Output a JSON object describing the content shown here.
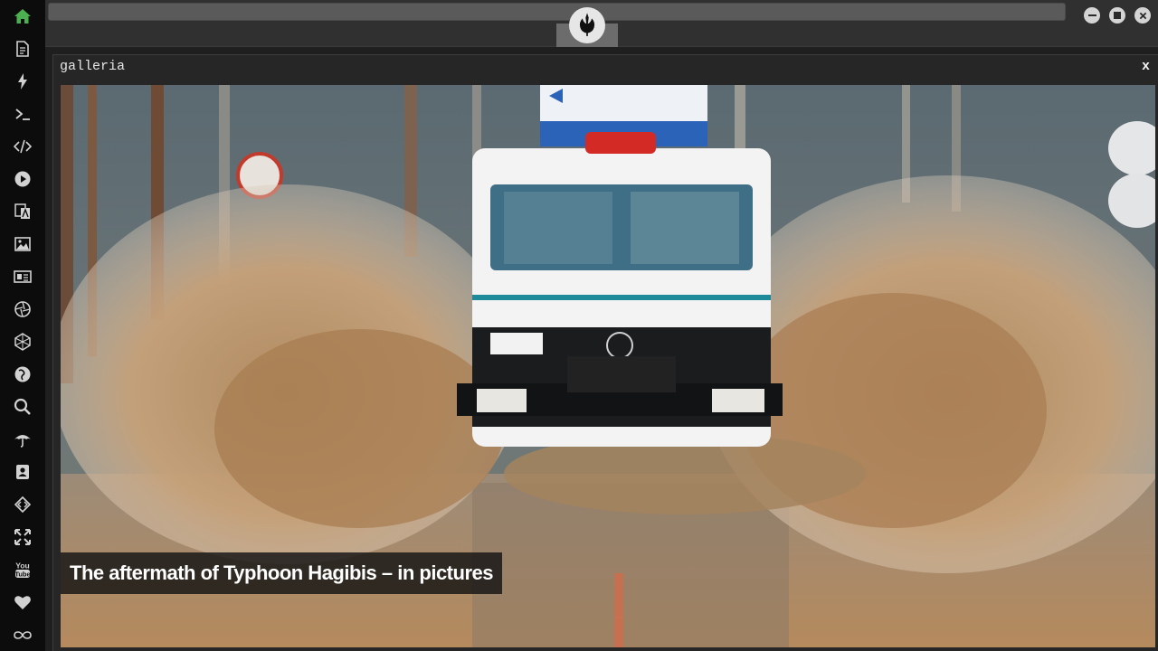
{
  "window": {
    "controls": [
      {
        "name": "minimize-icon"
      },
      {
        "name": "maximize-icon"
      },
      {
        "name": "close-icon"
      }
    ]
  },
  "sidebar": {
    "items": [
      {
        "name": "home-icon",
        "color": "#4caf50"
      },
      {
        "name": "document-icon"
      },
      {
        "name": "lightning-icon"
      },
      {
        "name": "terminal-icon"
      },
      {
        "name": "code-icon"
      },
      {
        "name": "play-icon"
      },
      {
        "name": "translate-icon"
      },
      {
        "name": "image-icon"
      },
      {
        "name": "news-icon"
      },
      {
        "name": "aperture-icon"
      },
      {
        "name": "polyhedron-icon"
      },
      {
        "name": "globe-icon"
      },
      {
        "name": "search-icon"
      },
      {
        "name": "umbrella-icon"
      },
      {
        "name": "contact-icon"
      },
      {
        "name": "diamond-code-icon"
      },
      {
        "name": "expand-icon"
      },
      {
        "name": "youtube-icon",
        "label": "You Tube"
      },
      {
        "name": "heart-icon"
      },
      {
        "name": "infinity-cloud-icon"
      }
    ]
  },
  "emblem": {
    "icon": "rebel-alliance-icon"
  },
  "gallery": {
    "title": "galleria",
    "close_label": "x",
    "caption": "The aftermath of Typhoon Hagibis – in pictures",
    "photo": {
      "subject": "photo"
    }
  }
}
